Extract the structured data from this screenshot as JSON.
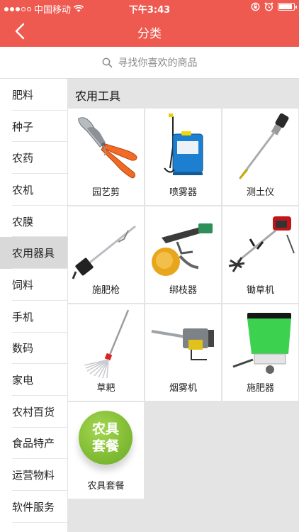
{
  "status_bar": {
    "carrier": "中国移动",
    "time": "下午3:43"
  },
  "nav": {
    "title": "分类"
  },
  "search": {
    "placeholder": "寻找你喜欢的商品"
  },
  "sidebar": {
    "items": [
      {
        "label": "肥料"
      },
      {
        "label": "种子"
      },
      {
        "label": "农药"
      },
      {
        "label": "农机"
      },
      {
        "label": "农膜"
      },
      {
        "label": "农用器具"
      },
      {
        "label": "饲料"
      },
      {
        "label": "手机"
      },
      {
        "label": "数码"
      },
      {
        "label": "家电"
      },
      {
        "label": "农村百货"
      },
      {
        "label": "食品特产"
      },
      {
        "label": "运营物料"
      },
      {
        "label": "软件服务"
      }
    ],
    "active_index": 5
  },
  "content": {
    "section_title": "农用工具",
    "products": [
      {
        "name": "园艺剪"
      },
      {
        "name": "喷雾器"
      },
      {
        "name": "测土仪"
      },
      {
        "name": "施肥枪"
      },
      {
        "name": "绑枝器"
      },
      {
        "name": "锄草机"
      },
      {
        "name": "草耙"
      },
      {
        "name": "烟雾机"
      },
      {
        "name": "施肥器"
      },
      {
        "name": "农具套餐",
        "badge": [
          "农具",
          "套餐"
        ]
      }
    ]
  },
  "colors": {
    "brand": "#ef5a50",
    "sidebar_active": "#d9d9d9",
    "content_bg": "#e4e4e4"
  }
}
